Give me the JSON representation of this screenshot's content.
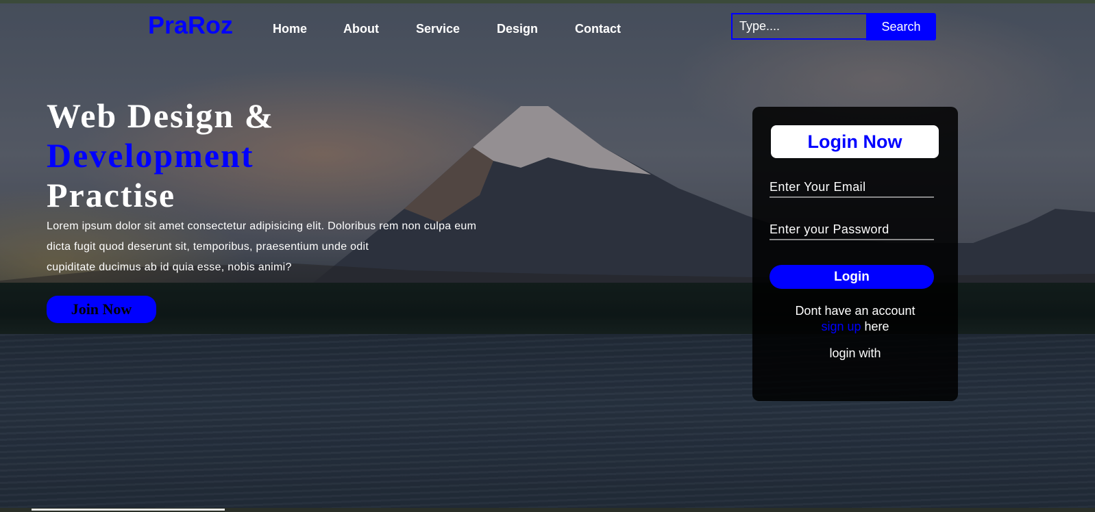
{
  "brand": {
    "name": "PraRoz"
  },
  "nav": {
    "items": [
      "Home",
      "About",
      "Service",
      "Design",
      "Contact"
    ]
  },
  "search": {
    "placeholder": "Type....",
    "button_label": "Search"
  },
  "hero": {
    "title_line1": "Web Design &",
    "title_line2": "Development",
    "title_line3": "Practise",
    "text_line1": "Lorem ipsum dolor sit amet consectetur adipisicing elit. Doloribus rem non culpa eum",
    "text_line2": "dicta fugit quod deserunt sit, temporibus, praesentium unde odit",
    "text_line3": "cupiditate ducimus ab id quia esse, nobis animi?",
    "cta_label": "Join Now"
  },
  "login": {
    "title": "Login Now",
    "email_placeholder": "Enter Your Email",
    "password_placeholder": "Enter your Password",
    "button_label": "Login",
    "no_account_text": "Dont have an account",
    "signup_link": "sign up",
    "signup_suffix": " here",
    "login_with": "login with"
  },
  "colors": {
    "accent": "#0000ff",
    "text": "#ffffff",
    "card_bg": "#000000"
  }
}
